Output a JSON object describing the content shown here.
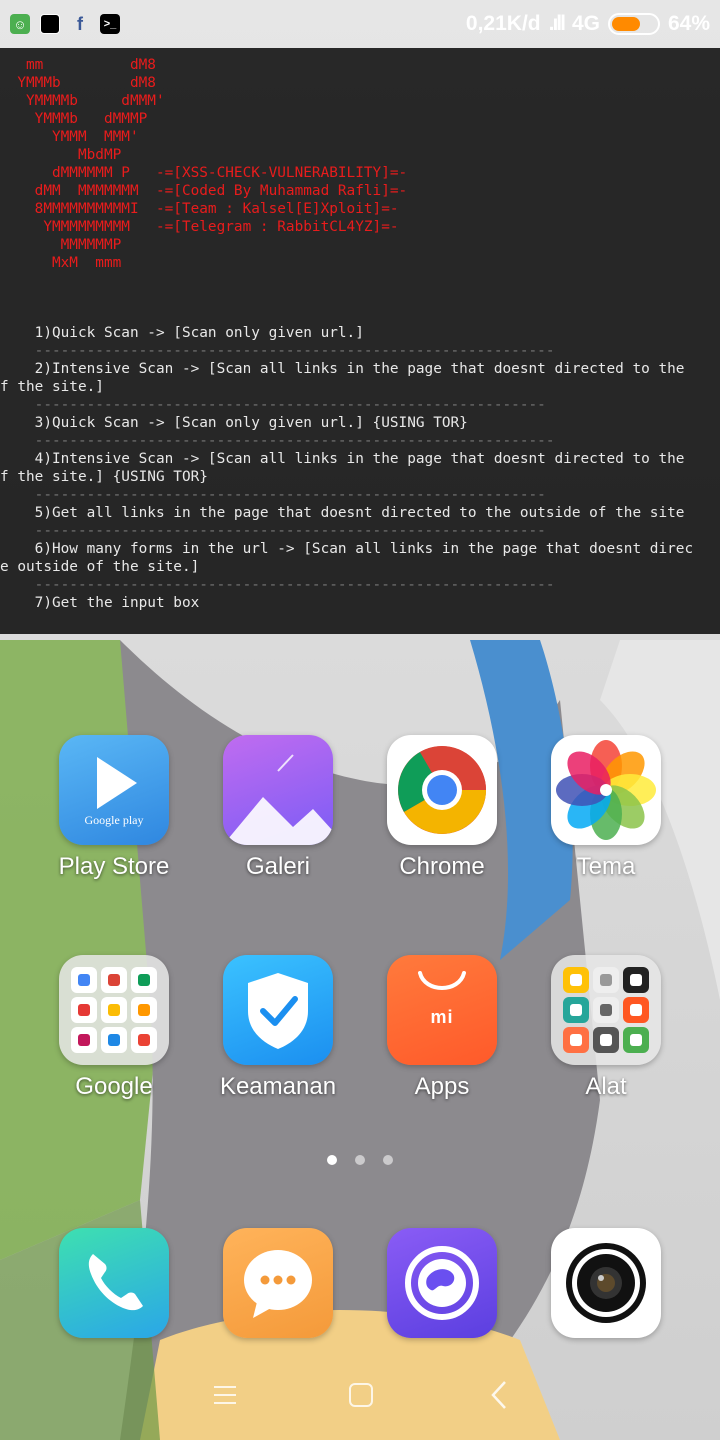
{
  "status_bar": {
    "left_icons": [
      "android-icon",
      "square-icon",
      "facebook-icon",
      "terminal-icon"
    ],
    "speed": "0,21K/d",
    "network": "4G",
    "battery_percent": "64%",
    "battery_level": 0.64,
    "battery_color": "#ff8a00"
  },
  "terminal": {
    "banner_lines": [
      "   mm          dM8",
      "  YMMMb        dM8",
      "   YMMMMb     dMMM'",
      "    YMMMb   dMMMP",
      "      YMMM  MMM'",
      "         MbdMP",
      "      dMMMMMM P   -=[XSS-CHECK-VULNERABILITY]=-",
      "    dMM  MMMMMMM  -=[Coded By Muhammad Rafli]=-",
      "    8MMMMMMMMMMI  -=[Team : Kalsel[E]Xploit]=-",
      "     YMMMMMMMMM   -=[Telegram : RabbitCL4YZ]=-",
      "       MMMMMMP",
      "      MxM  mmm"
    ],
    "menu_lines": [
      "    1)Quick Scan -> [Scan only given url.]",
      "    ------------------------------------------------------------",
      "    2)Intensive Scan -> [Scan all links in the page that doesnt directed to the",
      "f the site.]",
      "    -----------------------------------------------------------",
      "    3)Quick Scan -> [Scan only given url.] {USING TOR}",
      "    ------------------------------------------------------------",
      "    4)Intensive Scan -> [Scan all links in the page that doesnt directed to the",
      "f the site.] {USING TOR}",
      "    -----------------------------------------------------------",
      "    5)Get all links in the page that doesnt directed to the outside of the site",
      "    -----------------------------------------------------------",
      "    6)How many forms in the url -> [Scan all links in the page that doesnt direc",
      "e outside of the site.]",
      "    ------------------------------------------------------------",
      "    7)Get the input box"
    ]
  },
  "apps": [
    {
      "label": "Play Store",
      "icon": "play-store-icon",
      "sub": "Google play"
    },
    {
      "label": "Galeri",
      "icon": "gallery-icon"
    },
    {
      "label": "Chrome",
      "icon": "chrome-icon"
    },
    {
      "label": "Tema",
      "icon": "theme-icon"
    },
    {
      "label": "Google",
      "icon": "google-folder-icon"
    },
    {
      "label": "Keamanan",
      "icon": "security-shield-icon"
    },
    {
      "label": "Apps",
      "icon": "mi-apps-icon",
      "sub": "mi"
    },
    {
      "label": "Alat",
      "icon": "tools-folder-icon"
    }
  ],
  "dock": [
    {
      "icon": "phone-icon"
    },
    {
      "icon": "messages-icon"
    },
    {
      "icon": "browser-icon"
    },
    {
      "icon": "camera-icon"
    }
  ],
  "page_dots": {
    "count": 3,
    "active": 1
  },
  "nav": [
    "menu-icon",
    "home-icon",
    "back-icon"
  ]
}
